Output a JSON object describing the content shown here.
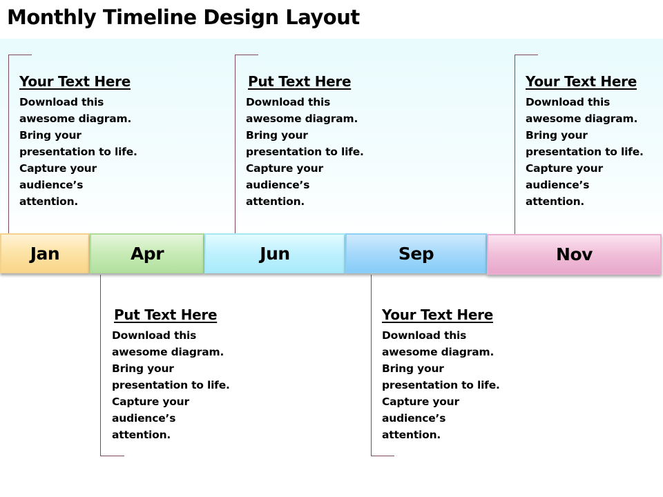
{
  "title": "Monthly Timeline Design Layout",
  "months": [
    {
      "label": "Jan",
      "color": "#fde4a8"
    },
    {
      "label": "Apr",
      "color": "#c8ebb6"
    },
    {
      "label": "Jun",
      "color": "#bff1fd"
    },
    {
      "label": "Sep",
      "color": "#a6d9fb"
    },
    {
      "label": "Nov",
      "color": "#f0bfd9"
    }
  ],
  "callouts": [
    {
      "month": "Jan",
      "position": "above",
      "heading": "Your Text Here",
      "lines": [
        "Download this",
        "awesome diagram.",
        "Bring your",
        "presentation to life.",
        "Capture your",
        "audience’s",
        "attention."
      ]
    },
    {
      "month": "Apr",
      "position": "below",
      "heading": "Put Text Here",
      "lines": [
        "Download this",
        "awesome diagram.",
        "Bring your",
        "presentation to life.",
        "Capture your",
        "audience’s",
        "attention."
      ]
    },
    {
      "month": "Jun",
      "position": "above",
      "heading": "Put Text Here",
      "lines": [
        "Download this",
        "awesome diagram.",
        "Bring your",
        "presentation to life.",
        "Capture your",
        "audience’s",
        "attention."
      ]
    },
    {
      "month": "Sep",
      "position": "below",
      "heading": "Your Text Here",
      "lines": [
        "Download this",
        "awesome diagram.",
        "Bring your",
        "presentation to life.",
        "Capture your",
        "audience’s",
        "attention."
      ]
    },
    {
      "month": "Nov",
      "position": "above",
      "heading": "Your Text Here",
      "lines": [
        "Download this",
        "awesome diagram.",
        "Bring your",
        "presentation to life.",
        "Capture your",
        "audience’s",
        "attention."
      ]
    }
  ]
}
